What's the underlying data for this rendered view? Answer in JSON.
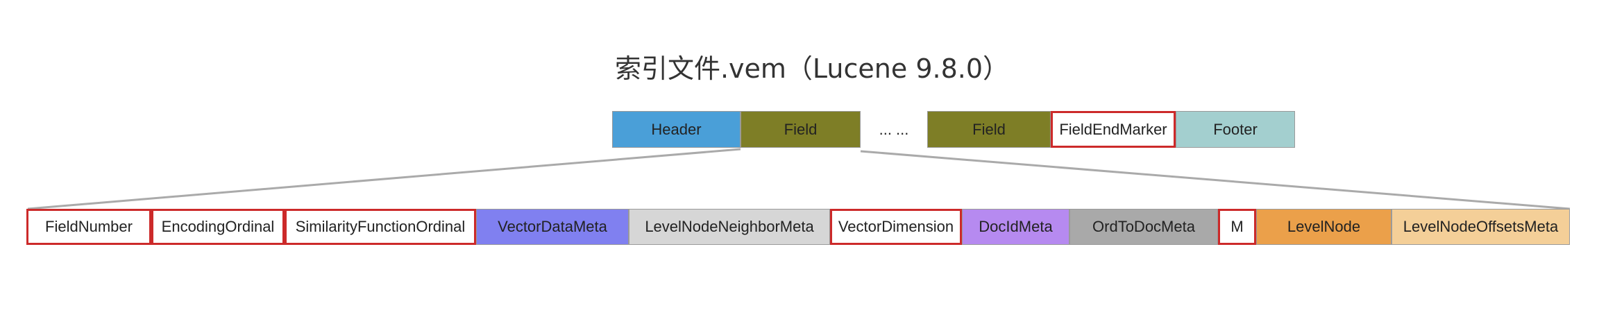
{
  "title": "索引文件.vem（Lucene 9.8.0）",
  "top_row": {
    "header": {
      "label": "Header",
      "color": "#4a9fd8"
    },
    "field_1": {
      "label": "Field",
      "color": "#7e7e26"
    },
    "ellipsis": "... ...",
    "field_2": {
      "label": "Field",
      "color": "#7e7e26"
    },
    "field_end_marker": {
      "label": "FieldEndMarker",
      "color": "#ffffff",
      "highlighted": true
    },
    "footer": {
      "label": "Footer",
      "color": "#a3cfcf"
    }
  },
  "field_row": [
    {
      "label": "FieldNumber",
      "color": "#ffffff",
      "highlighted": true
    },
    {
      "label": "EncodingOrdinal",
      "color": "#ffffff",
      "highlighted": true
    },
    {
      "label": "SimilarityFunctionOrdinal",
      "color": "#ffffff",
      "highlighted": true
    },
    {
      "label": "VectorDataMeta",
      "color": "#8080f0",
      "highlighted": false
    },
    {
      "label": "LevelNodeNeighborMeta",
      "color": "#d6d6d6",
      "highlighted": false
    },
    {
      "label": "VectorDimension",
      "color": "#ffffff",
      "highlighted": true
    },
    {
      "label": "DocIdMeta",
      "color": "#b68af0",
      "highlighted": false
    },
    {
      "label": "OrdToDocMeta",
      "color": "#a9a9a9",
      "highlighted": false
    },
    {
      "label": "M",
      "color": "#ffffff",
      "highlighted": true
    },
    {
      "label": "LevelNode",
      "color": "#eba04a",
      "highlighted": false
    },
    {
      "label": "LevelNodeOffsetsMeta",
      "color": "#f4cf98",
      "highlighted": false
    }
  ],
  "colors": {
    "highlight_border": "#cc2a2a",
    "connector_line": "#aaaaaa"
  }
}
